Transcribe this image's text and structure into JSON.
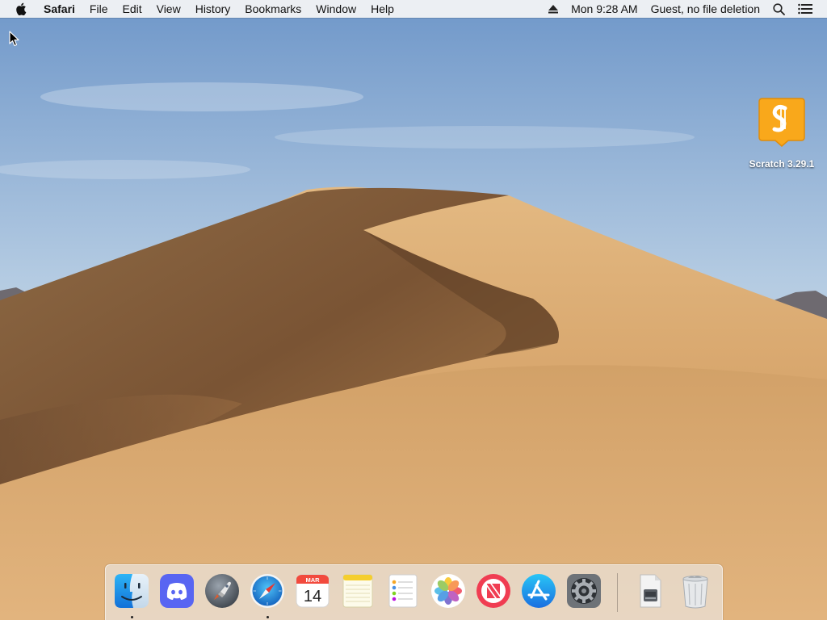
{
  "menubar": {
    "app_name": "Safari",
    "items": [
      "File",
      "Edit",
      "View",
      "History",
      "Bookmarks",
      "Window",
      "Help"
    ],
    "clock": "Mon 9:28 AM",
    "user": "Guest, no file deletion"
  },
  "desktop": {
    "icons": [
      {
        "label": "Scratch 3.29.1",
        "color": "#F9A81B"
      }
    ]
  },
  "dock": {
    "apps": [
      {
        "name": "Finder",
        "icon": "finder-icon",
        "running": true
      },
      {
        "name": "Discord",
        "icon": "discord-icon",
        "running": false
      },
      {
        "name": "Launchpad",
        "icon": "launchpad-icon",
        "running": false
      },
      {
        "name": "Safari",
        "icon": "safari-icon",
        "running": true
      },
      {
        "name": "Calendar",
        "icon": "calendar-icon",
        "running": false,
        "month": "MAR",
        "day": "14"
      },
      {
        "name": "Notes",
        "icon": "notes-icon",
        "running": false
      },
      {
        "name": "Reminders",
        "icon": "reminders-icon",
        "running": false
      },
      {
        "name": "Photos",
        "icon": "photos-icon",
        "running": false
      },
      {
        "name": "News",
        "icon": "news-icon",
        "running": false
      },
      {
        "name": "App Store",
        "icon": "app-store-icon",
        "running": false
      },
      {
        "name": "System Preferences",
        "icon": "system-preferences-icon",
        "running": false
      }
    ],
    "others": [
      {
        "name": "Downloads",
        "icon": "downloads-stack-icon"
      },
      {
        "name": "Trash",
        "icon": "trash-icon"
      }
    ]
  },
  "colors": {
    "menubar_bg": "#F6F6F6",
    "sky_top": "#6F97C9",
    "sand": "#D9A86A",
    "dock_bg": "#ECECEC"
  }
}
